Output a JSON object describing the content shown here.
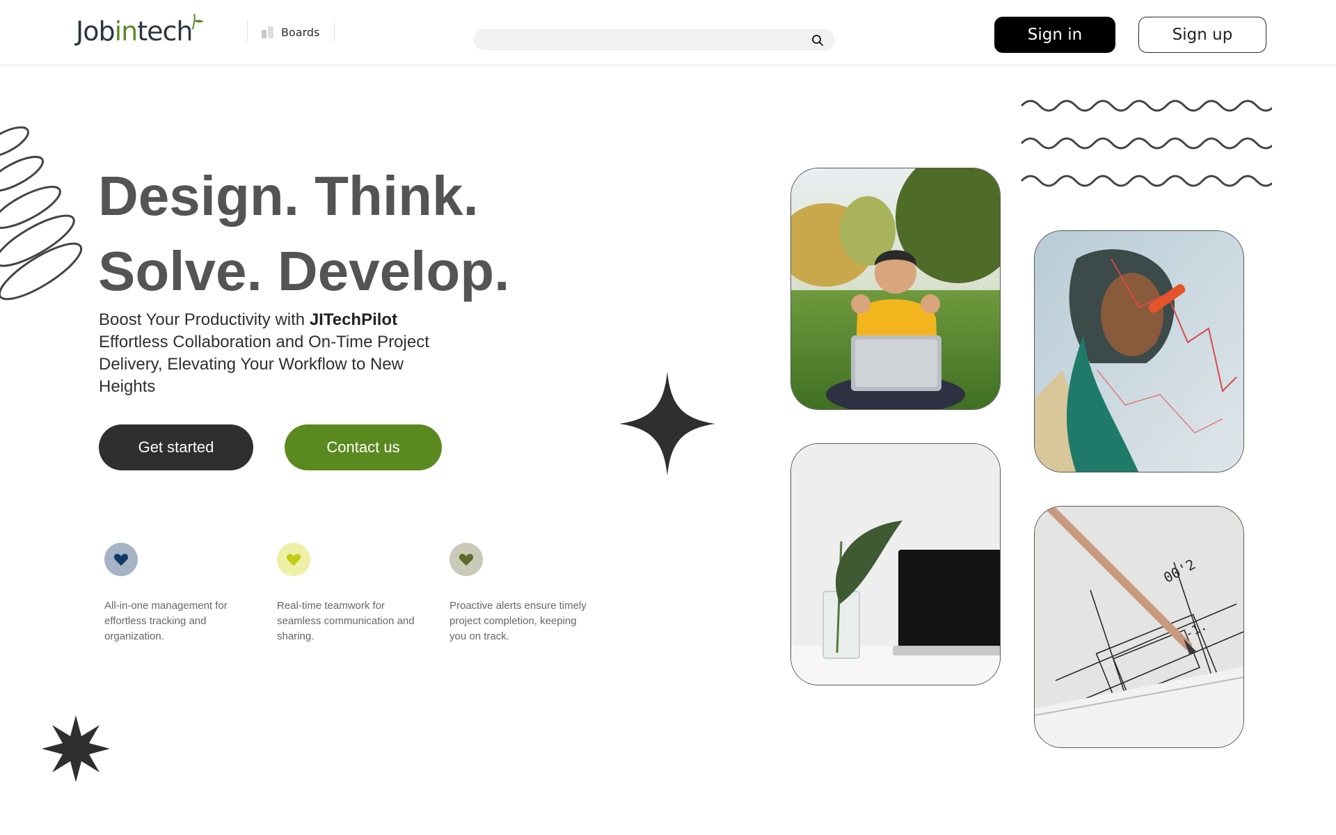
{
  "header": {
    "logo": {
      "prefix": "Job",
      "accent": "in",
      "suffix": "tech"
    },
    "boards_label": "Boards",
    "search": {
      "placeholder": "",
      "value": ""
    },
    "signin_label": "Sign in",
    "signup_label": "Sign up"
  },
  "hero": {
    "title_line1": "Design. Think.",
    "title_line2": "Solve. Develop.",
    "desc_lead": "Boost Your Productivity with ",
    "desc_brand": "JITechPilot",
    "desc_rest": "Effortless Collaboration and On-Time Project Delivery, Elevating Your Workflow to New Heights",
    "get_started_label": "Get started",
    "contact_label": "Contact us"
  },
  "features": [
    {
      "text": "All-in-one management for effortless tracking and organization.",
      "icon": "heart-icon",
      "bg": "#a5b3c4",
      "color": "#123a66"
    },
    {
      "text": "Real-time teamwork for seamless communication and sharing.",
      "icon": "heart-icon",
      "bg": "#eef0a8",
      "color": "#c2cc12"
    },
    {
      "text": "Proactive alerts ensure timely project completion, keeping you on track.",
      "icon": "heart-icon",
      "bg": "#c9cab7",
      "color": "#5a6b2a"
    }
  ],
  "colors": {
    "accent": "#5a8a1f",
    "dark": "#2f2f2f",
    "title": "#545454"
  },
  "photos": [
    {
      "name": "photo-man-laptop",
      "subject": "excited man with laptop on grass"
    },
    {
      "name": "photo-woman-glass",
      "subject": "woman drawing on glass board"
    },
    {
      "name": "photo-plant-laptop",
      "subject": "plant in glass beside laptop"
    },
    {
      "name": "photo-blueprint",
      "subject": "pencil on technical drawing"
    }
  ]
}
